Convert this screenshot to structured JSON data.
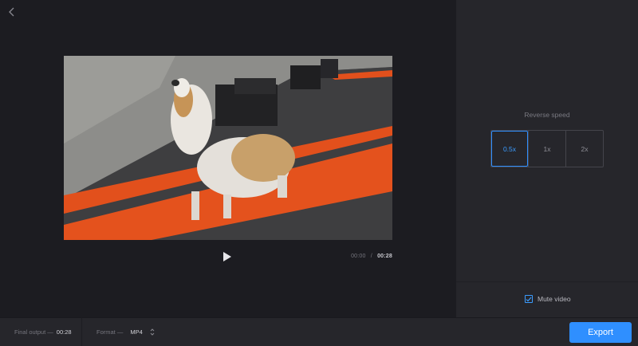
{
  "header": {
    "back_icon": "chevron-left-icon"
  },
  "player": {
    "play_icon": "play-icon",
    "current_time": "00:00",
    "separator": "/",
    "total_time": "00:28"
  },
  "speed": {
    "label": "Reverse speed",
    "options": [
      "0.5x",
      "1x",
      "2x"
    ],
    "selected": "0.5x"
  },
  "audio": {
    "mute_label": "Mute video",
    "mute_checked": true
  },
  "footer": {
    "final_output_label": "Final output —",
    "final_output_value": "00:28",
    "format_label": "Format —",
    "format_value": "MP4",
    "export_label": "Export"
  },
  "colors": {
    "accent": "#2f8fff",
    "panel": "#26262b",
    "background": "#1c1c21"
  }
}
